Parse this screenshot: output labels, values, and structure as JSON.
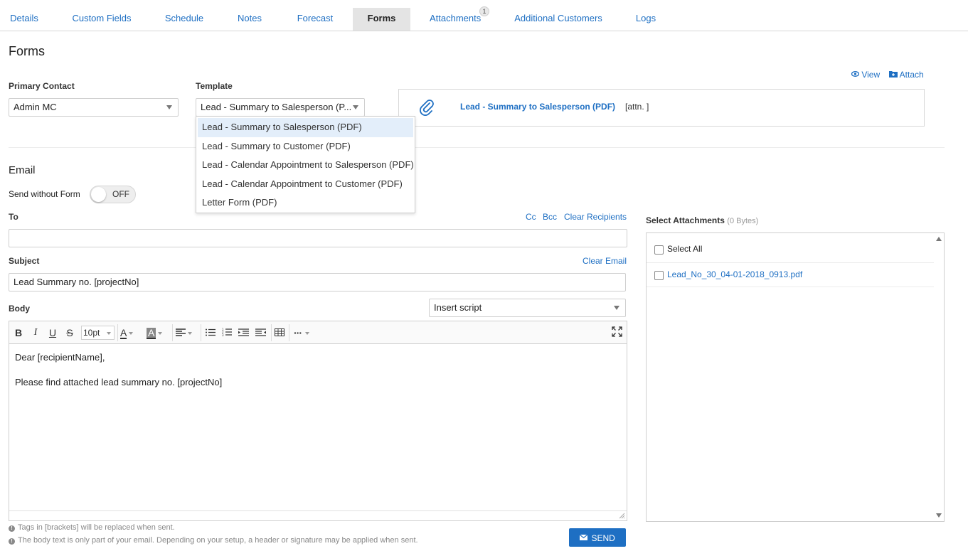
{
  "tabs": [
    {
      "label": "Details"
    },
    {
      "label": "Custom Fields"
    },
    {
      "label": "Schedule"
    },
    {
      "label": "Notes"
    },
    {
      "label": "Forecast"
    },
    {
      "label": "Forms"
    },
    {
      "label": "Attachments",
      "badge": "1"
    },
    {
      "label": "Additional Customers"
    },
    {
      "label": "Logs"
    }
  ],
  "active_tab": "Forms",
  "page_title": "Forms",
  "primary_contact": {
    "label": "Primary Contact",
    "value": "Admin MC"
  },
  "template": {
    "label": "Template",
    "value": "Lead - Summary to Salesperson (P...",
    "options": [
      "Lead - Summary to Salesperson (PDF)",
      "Lead - Summary to Customer (PDF)",
      "Lead - Calendar Appointment to Salesperson (PDF)",
      "Lead - Calendar Appointment to Customer (PDF)",
      "Letter Form (PDF)"
    ],
    "selected_index": 0
  },
  "form_actions": {
    "view": "View",
    "attach": "Attach"
  },
  "attached_form": {
    "name": "Lead - Summary to Salesperson (PDF)",
    "attn": "[attn. ]"
  },
  "email": {
    "heading": "Email",
    "send_without_form_label": "Send without Form",
    "toggle_state": "OFF",
    "to_label": "To",
    "to_value": "",
    "cc": "Cc",
    "bcc": "Bcc",
    "clear_recipients": "Clear Recipients",
    "subject_label": "Subject",
    "clear_email": "Clear Email",
    "subject_value": "Lead Summary no. [projectNo]",
    "body_label": "Body",
    "insert_script": "Insert script",
    "font_size": "10pt",
    "body_line1": "Dear [recipientName],",
    "body_line2": "Please find attached lead summary no. [projectNo]",
    "note1": "Tags in [brackets] will be replaced when sent.",
    "note2": "The body text is only part of your email. Depending on your setup, a header or signature may be applied when sent.",
    "send": "SEND"
  },
  "attachments": {
    "label": "Select Attachments",
    "size": "(0 Bytes)",
    "select_all": "Select All",
    "files": [
      "Lead_No_30_04-01-2018_0913.pdf"
    ]
  },
  "colors": {
    "accent": "#1e6fc3",
    "active_tab_bg": "#e4e4e4",
    "selected_option_bg": "#e3eefa"
  }
}
